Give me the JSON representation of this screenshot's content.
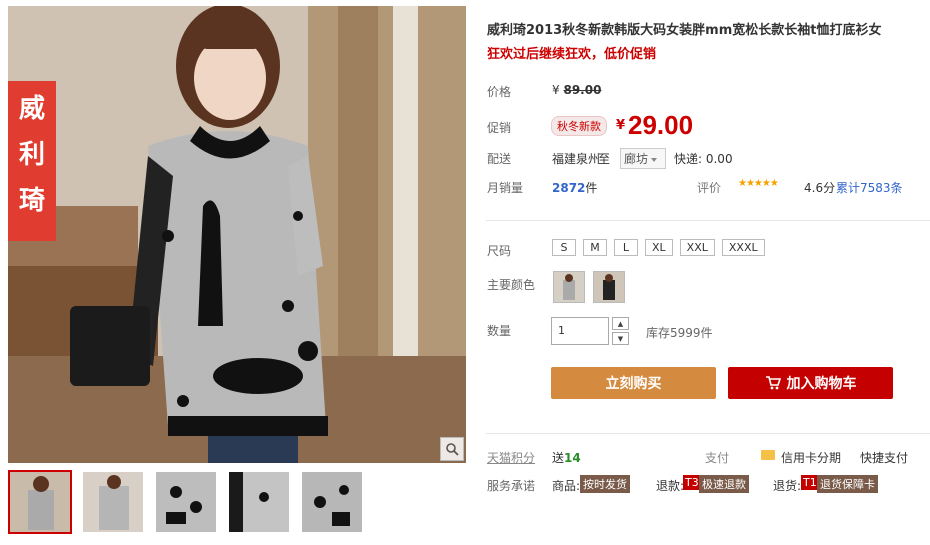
{
  "product": {
    "title": "威利琦2013秋冬新款韩版大码女装胖mm宽松长款长袖t恤打底衫女",
    "subtitle": "狂欢过后继续狂欢，低价促销",
    "brand_banner": "威利琦"
  },
  "price": {
    "label": "价格",
    "currency": "¥",
    "original": "89.00"
  },
  "promo": {
    "label": "促销",
    "tag": "秋冬新款",
    "currency": "¥",
    "price": "29.00"
  },
  "shipping": {
    "label": "配送",
    "from": "福建泉州",
    "to_word": "至",
    "city": "廊坊",
    "fee": "快递: 0.00"
  },
  "sales": {
    "label": "月销量",
    "count": "2872",
    "unit": "件",
    "rating_label": "评价",
    "stars": "★★★★★",
    "score": "4.6分",
    "total": "累计7583条"
  },
  "options": {
    "size_label": "尺码",
    "sizes": [
      "S",
      "M",
      "L",
      "XL",
      "XXL",
      "XXXL"
    ],
    "color_label": "主要颜色"
  },
  "quantity": {
    "label": "数量",
    "value": "1",
    "stock": "库存5999件",
    "up": "▲",
    "down": "▼"
  },
  "actions": {
    "buy": "立刻购买",
    "cart": "加入购物车"
  },
  "extra": {
    "points_label": "天猫积分",
    "points_prefix": "送",
    "points_value": "14",
    "pay_label": "支付",
    "credit": "信用卡分期",
    "quick": "快捷支付",
    "promise_label": "服务承诺",
    "p1_key": "商品:",
    "p1_val": "按时发货",
    "p2_key": "退款:",
    "p2_tag": "T3",
    "p2_val": "极速退款",
    "p3_key": "退货:",
    "p3_tag": "T1",
    "p3_val": "退货保障卡"
  },
  "colors": {
    "price_red": "#c40000",
    "buy_orange": "#d48a3f",
    "link_blue": "#3366cc"
  }
}
